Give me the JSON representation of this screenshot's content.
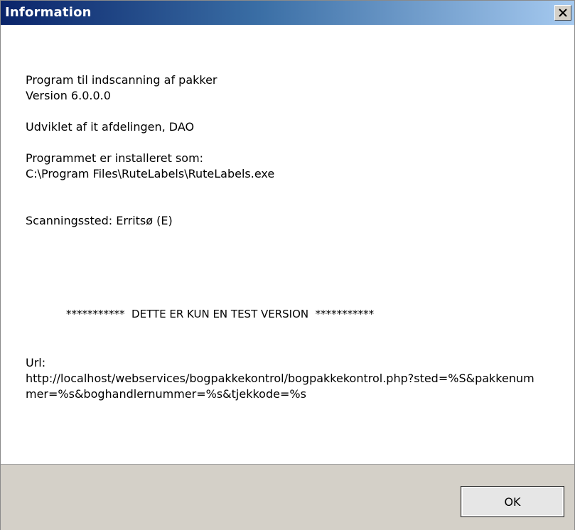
{
  "window": {
    "title": "Information",
    "close_icon": "close-icon"
  },
  "body": {
    "program_name": "Program til indscanning af pakker",
    "version": "Version 6.0.0.0",
    "developer": "Udviklet af it afdelingen, DAO",
    "installed_label": "Programmet er installeret som:",
    "installed_path": "C:\\Program Files\\RuteLabels\\RuteLabels.exe",
    "scan_location": "Scanningssted: Erritsø  (E)",
    "test_notice": "***********  DETTE ER KUN EN TEST VERSION  ***********",
    "url_label": "Url:",
    "url_value": "http://localhost/webservices/bogpakkekontrol/bogpakkekontrol.php?sted=%S&pakkenummer=%s&boghandlernummer=%s&tjekkode=%s"
  },
  "footer": {
    "ok_label": "OK"
  }
}
